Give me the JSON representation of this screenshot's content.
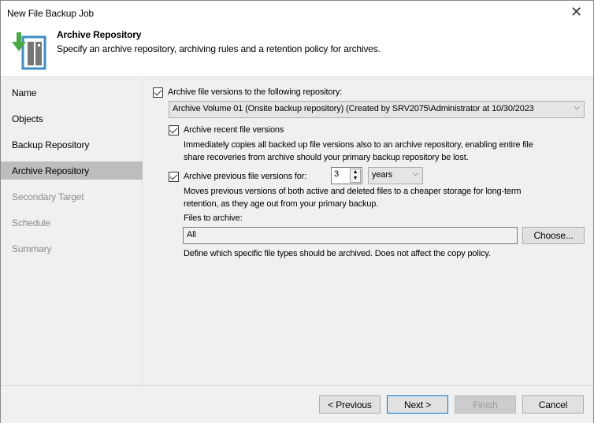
{
  "window": {
    "title": "New File Backup Job"
  },
  "header": {
    "title": "Archive Repository",
    "subtitle": "Specify an archive repository, archiving rules and a retention policy for archives."
  },
  "sidebar": {
    "items": [
      {
        "label": "Name",
        "state": "normal"
      },
      {
        "label": "Objects",
        "state": "normal"
      },
      {
        "label": "Backup Repository",
        "state": "normal"
      },
      {
        "label": "Archive Repository",
        "state": "selected"
      },
      {
        "label": "Secondary Target",
        "state": "disabled"
      },
      {
        "label": "Schedule",
        "state": "disabled"
      },
      {
        "label": "Summary",
        "state": "disabled"
      }
    ]
  },
  "main": {
    "archive_to_repo_label": "Archive file versions to the following repository:",
    "archive_to_repo_checked": true,
    "repository_value": "Archive Volume 01 (Onsite backup repository) (Created by SRV2075\\Administrator at 10/30/2023",
    "recent_label": "Archive recent file versions",
    "recent_checked": true,
    "recent_desc1": "Immediately copies all backed up file versions also to an archive repository, enabling entire file",
    "recent_desc2": "share recoveries from archive should your primary backup repository be lost.",
    "previous_label": "Archive previous file versions for:",
    "previous_checked": true,
    "previous_value": "3",
    "previous_unit": "years",
    "previous_desc1": "Moves previous versions of both active and deleted files to a cheaper storage for long-term",
    "previous_desc2": "retention, as they age out from your primary backup.",
    "files_label": "Files to archive:",
    "files_value": "All",
    "choose_label": "Choose...",
    "files_desc": "Define which specific file types should be archived. Does not affect the copy policy."
  },
  "footer": {
    "previous": "< Previous",
    "next": "Next >",
    "finish": "Finish",
    "cancel": "Cancel"
  }
}
